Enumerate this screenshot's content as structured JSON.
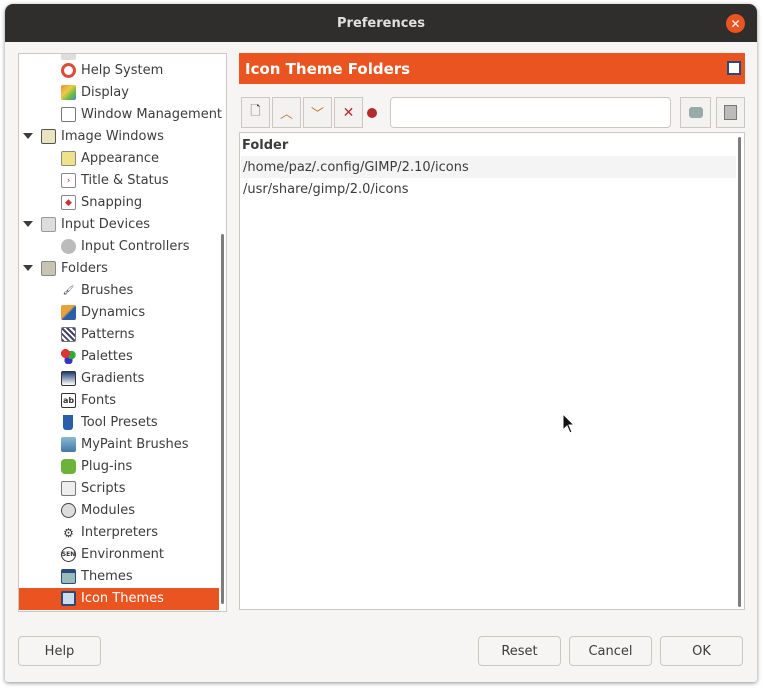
{
  "window": {
    "title": "Preferences"
  },
  "sidebar": {
    "items": [
      {
        "label": "Help System",
        "icon": "help-system-icon"
      },
      {
        "label": "Display",
        "icon": "display-icon"
      },
      {
        "label": "Window Management",
        "icon": "window-management-icon"
      },
      {
        "label": "Image Windows",
        "icon": "image-windows-icon",
        "expanded": true
      },
      {
        "label": "Appearance",
        "icon": "appearance-icon"
      },
      {
        "label": "Title & Status",
        "icon": "title-status-icon"
      },
      {
        "label": "Snapping",
        "icon": "snapping-icon"
      },
      {
        "label": "Input Devices",
        "icon": "input-devices-icon",
        "expanded": true
      },
      {
        "label": "Input Controllers",
        "icon": "input-controllers-icon"
      },
      {
        "label": "Folders",
        "icon": "folders-icon",
        "expanded": true
      },
      {
        "label": "Brushes",
        "icon": "brushes-icon"
      },
      {
        "label": "Dynamics",
        "icon": "dynamics-icon"
      },
      {
        "label": "Patterns",
        "icon": "patterns-icon"
      },
      {
        "label": "Palettes",
        "icon": "palettes-icon"
      },
      {
        "label": "Gradients",
        "icon": "gradients-icon"
      },
      {
        "label": "Fonts",
        "icon": "fonts-icon"
      },
      {
        "label": "Tool Presets",
        "icon": "tool-presets-icon"
      },
      {
        "label": "MyPaint Brushes",
        "icon": "mypaint-brushes-icon"
      },
      {
        "label": "Plug-ins",
        "icon": "plug-ins-icon"
      },
      {
        "label": "Scripts",
        "icon": "scripts-icon"
      },
      {
        "label": "Modules",
        "icon": "modules-icon"
      },
      {
        "label": "Interpreters",
        "icon": "interpreters-icon"
      },
      {
        "label": "Environment",
        "icon": "environment-icon"
      },
      {
        "label": "Themes",
        "icon": "themes-icon"
      },
      {
        "label": "Icon Themes",
        "icon": "icon-themes-icon",
        "selected": true
      }
    ]
  },
  "panel": {
    "title": "Icon Theme Folders",
    "path_value": "",
    "column_header": "Folder",
    "folders": [
      "/home/paz/.config/GIMP/2.10/icons",
      "/usr/share/gimp/2.0/icons"
    ]
  },
  "buttons": {
    "help": "Help",
    "reset": "Reset",
    "cancel": "Cancel",
    "ok": "OK"
  },
  "colors": {
    "accent": "#e95420",
    "titlebar": "#2f2e2c"
  }
}
